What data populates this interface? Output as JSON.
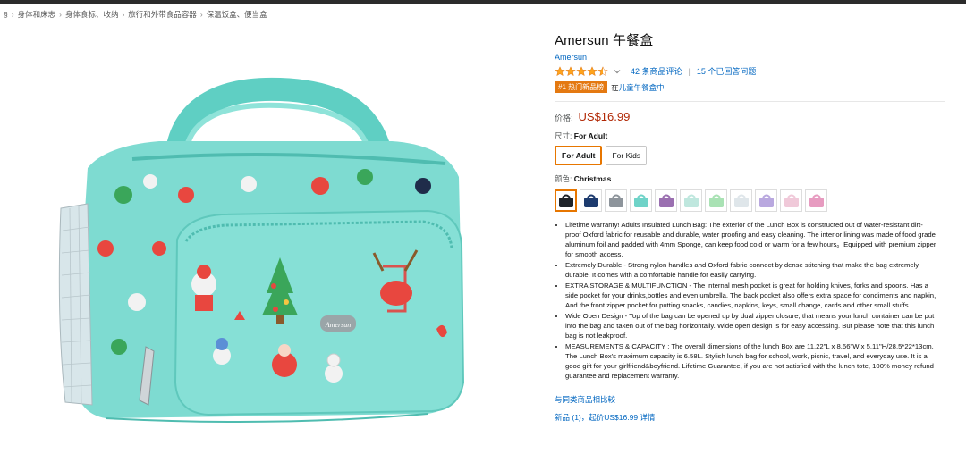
{
  "breadcrumb": {
    "items": [
      "§",
      "身体和床志",
      "身体食标、收纳",
      "旅行和外带食品容器",
      "保温饭盒、便当盒"
    ]
  },
  "product": {
    "title": "Amersun 午餐盒",
    "brand": "Amersun",
    "rating_stars": 4.5,
    "ratings_count": "42 条商品评论",
    "answered_questions": "15 个已回答问题",
    "bestseller_badge": "#1 热门新品榜",
    "bestseller_prefix": "在",
    "bestseller_category": "儿童午餐盒中",
    "price_label": "价格:",
    "price": "US$16.99",
    "size_label": "尺寸:",
    "size_selected": "For Adult",
    "size_options": [
      "For Adult",
      "For Kids"
    ],
    "color_label": "颜色:",
    "color_selected": "Christmas",
    "swatches": [
      {
        "name": "black",
        "color": "#1e2329"
      },
      {
        "name": "navy",
        "color": "#1d3b6e"
      },
      {
        "name": "grey",
        "color": "#8d949b"
      },
      {
        "name": "teal-christmas",
        "color": "#6fd3c8"
      },
      {
        "name": "purple",
        "color": "#9a6fb0"
      },
      {
        "name": "mint-pattern",
        "color": "#bfe7de"
      },
      {
        "name": "light-green",
        "color": "#a9e2b4"
      },
      {
        "name": "white-pattern",
        "color": "#dfe6ea"
      },
      {
        "name": "lavender-pattern",
        "color": "#b9a8df"
      },
      {
        "name": "pink-light",
        "color": "#f0c9d9"
      },
      {
        "name": "pink",
        "color": "#e79bc0"
      }
    ],
    "bullets": [
      "Lifetime warranty! Adults Insulated Lunch Bag: The exterior of the Lunch Box is constructed out of water-resistant dirt-proof Oxford fabric for reusable and durable, water proofing and easy cleaning. The interior lining was made of food grade aluminum foil and padded with 4mm Sponge, can keep food cold or warm for a few hours。Equipped with premium zipper for smooth access.",
      "Extremely Durable - Strong nylon handles and Oxford fabric connect by dense stitching that make the bag extremely durable. It comes with a comfortable handle for easily carrying.",
      "EXTRA STORAGE & MULTIFUNCTION - The internal mesh pocket is great for holding knives, forks and spoons. Has a side pocket for your drinks,bottles and even umbrella. The back pocket also offers extra space for condiments and napkin, And the front zipper pocket for putting snacks, candies, napkins, keys, small change, cards and other small stuffs.",
      "Wide Open Design - Top of the bag can be opened up by dual zipper closure, that means your lunch container can be put into the bag and taken out of the bag horizontally. Wide open design is for easy accessing. But please note that this lunch bag is not leakproof.",
      "MEASUREMENTS & CAPACITY : The overall dimensions of the lunch Box are 11.22\"L x 8.66\"W x 5.11\"H/28.5*22*13cm. The Lunch Box's maximum capacity is 6.58L. Stylish lunch bag for school, work, picnic, travel, and everyday use. It is a good gift for your girlfriend&boyfriend. Lifetime Guarantee, if you are not satisfied with the lunch tote, 100% money refund guarantee and replacement warranty."
    ],
    "compare_link": "与同类商品相比较",
    "new_offers": "新品 (1)，起价US$16.99 详情",
    "image_brand_tag": "Amersun"
  },
  "colors": {
    "link": "#0066c0",
    "price": "#b12704",
    "badge": "#e47911",
    "selected_border": "#e77600",
    "bag_teal": "#79d8cf"
  }
}
